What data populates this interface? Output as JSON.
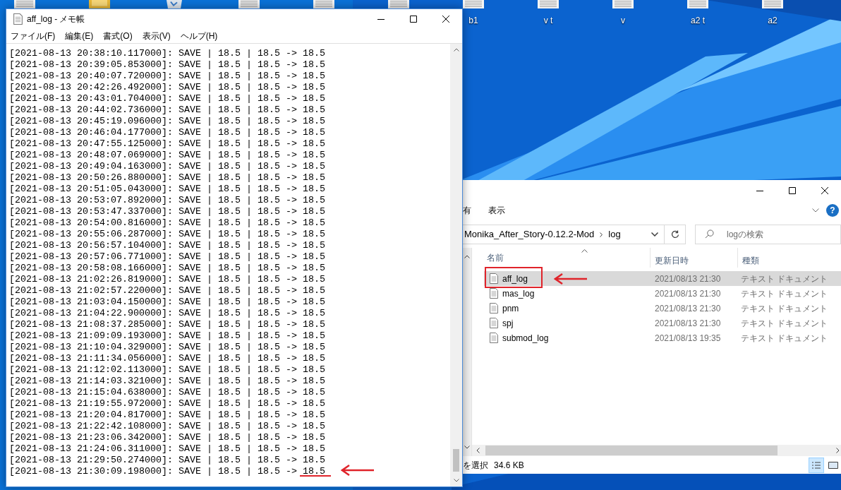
{
  "desktop": {
    "icons": [
      {
        "kind": "document"
      },
      {
        "kind": "folder"
      },
      {
        "kind": "bin"
      },
      {
        "kind": "document"
      },
      {
        "kind": "document"
      },
      {
        "kind": "document"
      },
      {
        "kind": "document",
        "label": "b1"
      },
      {
        "kind": "document",
        "label": "v t"
      },
      {
        "kind": "document",
        "label": "v"
      },
      {
        "kind": "document",
        "label": "a2 t"
      },
      {
        "kind": "document",
        "label": "a2"
      }
    ]
  },
  "notepad": {
    "title": "aff_log - メモ帳",
    "menu": [
      "ファイル(F)",
      "編集(E)",
      "書式(O)",
      "表示(V)",
      "ヘルプ(H)"
    ],
    "lines": [
      {
        "text": "[2021-08-13 20:38:10.117000]: SAVE | 18.5 | 18.5 -> 18.5",
        "marked": false
      },
      {
        "text": "[2021-08-13 20:39:05.853000]: SAVE | 18.5 | 18.5 -> 18.5",
        "marked": false
      },
      {
        "text": "[2021-08-13 20:40:07.720000]: SAVE | 18.5 | 18.5 -> 18.5",
        "marked": false
      },
      {
        "text": "[2021-08-13 20:42:26.492000]: SAVE | 18.5 | 18.5 -> 18.5",
        "marked": false
      },
      {
        "text": "[2021-08-13 20:43:01.704000]: SAVE | 18.5 | 18.5 -> 18.5",
        "marked": false
      },
      {
        "text": "[2021-08-13 20:44:02.736000]: SAVE | 18.5 | 18.5 -> 18.5",
        "marked": false
      },
      {
        "text": "[2021-08-13 20:45:19.096000]: SAVE | 18.5 | 18.5 -> 18.5",
        "marked": false
      },
      {
        "text": "[2021-08-13 20:46:04.177000]: SAVE | 18.5 | 18.5 -> 18.5",
        "marked": false
      },
      {
        "text": "[2021-08-13 20:47:55.125000]: SAVE | 18.5 | 18.5 -> 18.5",
        "marked": false
      },
      {
        "text": "[2021-08-13 20:48:07.069000]: SAVE | 18.5 | 18.5 -> 18.5",
        "marked": false
      },
      {
        "text": "[2021-08-13 20:49:04.163000]: SAVE | 18.5 | 18.5 -> 18.5",
        "marked": false
      },
      {
        "text": "[2021-08-13 20:50:26.880000]: SAVE | 18.5 | 18.5 -> 18.5",
        "marked": false
      },
      {
        "text": "[2021-08-13 20:51:05.043000]: SAVE | 18.5 | 18.5 -> 18.5",
        "marked": false
      },
      {
        "text": "[2021-08-13 20:53:07.892000]: SAVE | 18.5 | 18.5 -> 18.5",
        "marked": false
      },
      {
        "text": "[2021-08-13 20:53:47.337000]: SAVE | 18.5 | 18.5 -> 18.5",
        "marked": false
      },
      {
        "text": "[2021-08-13 20:54:00.816000]: SAVE | 18.5 | 18.5 -> 18.5",
        "marked": false
      },
      {
        "text": "[2021-08-13 20:55:06.287000]: SAVE | 18.5 | 18.5 -> 18.5",
        "marked": false
      },
      {
        "text": "[2021-08-13 20:56:57.104000]: SAVE | 18.5 | 18.5 -> 18.5",
        "marked": false
      },
      {
        "text": "[2021-08-13 20:57:06.771000]: SAVE | 18.5 | 18.5 -> 18.5",
        "marked": false
      },
      {
        "text": "[2021-08-13 20:58:08.166000]: SAVE | 18.5 | 18.5 -> 18.5",
        "marked": false
      },
      {
        "text": "[2021-08-13 21:02:26.819000]: SAVE | 18.5 | 18.5 -> 18.5",
        "marked": false
      },
      {
        "text": "[2021-08-13 21:02:57.220000]: SAVE | 18.5 | 18.5 -> 18.5",
        "marked": false
      },
      {
        "text": "[2021-08-13 21:03:04.150000]: SAVE | 18.5 | 18.5 -> 18.5",
        "marked": false
      },
      {
        "text": "[2021-08-13 21:04:22.900000]: SAVE | 18.5 | 18.5 -> 18.5",
        "marked": false
      },
      {
        "text": "[2021-08-13 21:08:37.285000]: SAVE | 18.5 | 18.5 -> 18.5",
        "marked": false
      },
      {
        "text": "[2021-08-13 21:09:09.193000]: SAVE | 18.5 | 18.5 -> 18.5",
        "marked": false
      },
      {
        "text": "[2021-08-13 21:10:04.329000]: SAVE | 18.5 | 18.5 -> 18.5",
        "marked": false
      },
      {
        "text": "[2021-08-13 21:11:34.056000]: SAVE | 18.5 | 18.5 -> 18.5",
        "marked": false
      },
      {
        "text": "[2021-08-13 21:12:02.113000]: SAVE | 18.5 | 18.5 -> 18.5",
        "marked": false
      },
      {
        "text": "[2021-08-13 21:14:03.321000]: SAVE | 18.5 | 18.5 -> 18.5",
        "marked": false
      },
      {
        "text": "[2021-08-13 21:15:04.638000]: SAVE | 18.5 | 18.5 -> 18.5",
        "marked": false
      },
      {
        "text": "[2021-08-13 21:19:55.972000]: SAVE | 18.5 | 18.5 -> 18.5",
        "marked": false
      },
      {
        "text": "[2021-08-13 21:20:04.817000]: SAVE | 18.5 | 18.5 -> 18.5",
        "marked": false
      },
      {
        "text": "[2021-08-13 21:22:42.108000]: SAVE | 18.5 | 18.5 -> 18.5",
        "marked": false
      },
      {
        "text": "[2021-08-13 21:23:06.342000]: SAVE | 18.5 | 18.5 -> 18.5",
        "marked": false
      },
      {
        "text": "[2021-08-13 21:24:06.311000]: SAVE | 18.5 | 18.5 -> 18.5",
        "marked": false
      },
      {
        "text": "[2021-08-13 21:29:50.274000]: SAVE | 18.5 | 18.5 -> 18.5",
        "marked": false
      },
      {
        "text": "[2021-08-13 21:30:09.198000]: SAVE | 18.5 | 18.5 -> 18.5",
        "marked": true
      }
    ]
  },
  "explorer": {
    "ribbon_tabs": [
      "有",
      "表示"
    ],
    "help_label": "?",
    "path": [
      "Monika_After_Story-0.12.2-Mod",
      "log"
    ],
    "search": {
      "placeholder": "logの検索"
    },
    "columns": [
      "名前",
      "更新日時",
      "種類"
    ],
    "files": [
      {
        "name": "aff_log",
        "modified": "2021/08/13 21:30",
        "type": "テキスト ドキュメント",
        "selected": true,
        "marked": true
      },
      {
        "name": "mas_log",
        "modified": "2021/08/13 21:30",
        "type": "テキスト ドキュメント",
        "selected": false,
        "marked": false
      },
      {
        "name": "pnm",
        "modified": "2021/08/13 21:30",
        "type": "テキスト ドキュメント",
        "selected": false,
        "marked": false
      },
      {
        "name": "spj",
        "modified": "2021/08/13 21:30",
        "type": "テキスト ドキュメント",
        "selected": false,
        "marked": false
      },
      {
        "name": "submod_log",
        "modified": "2021/08/13 19:35",
        "type": "テキスト ドキュメント",
        "selected": false,
        "marked": false
      }
    ],
    "status": {
      "selection": "を選択",
      "size": "34.6 KB"
    }
  }
}
